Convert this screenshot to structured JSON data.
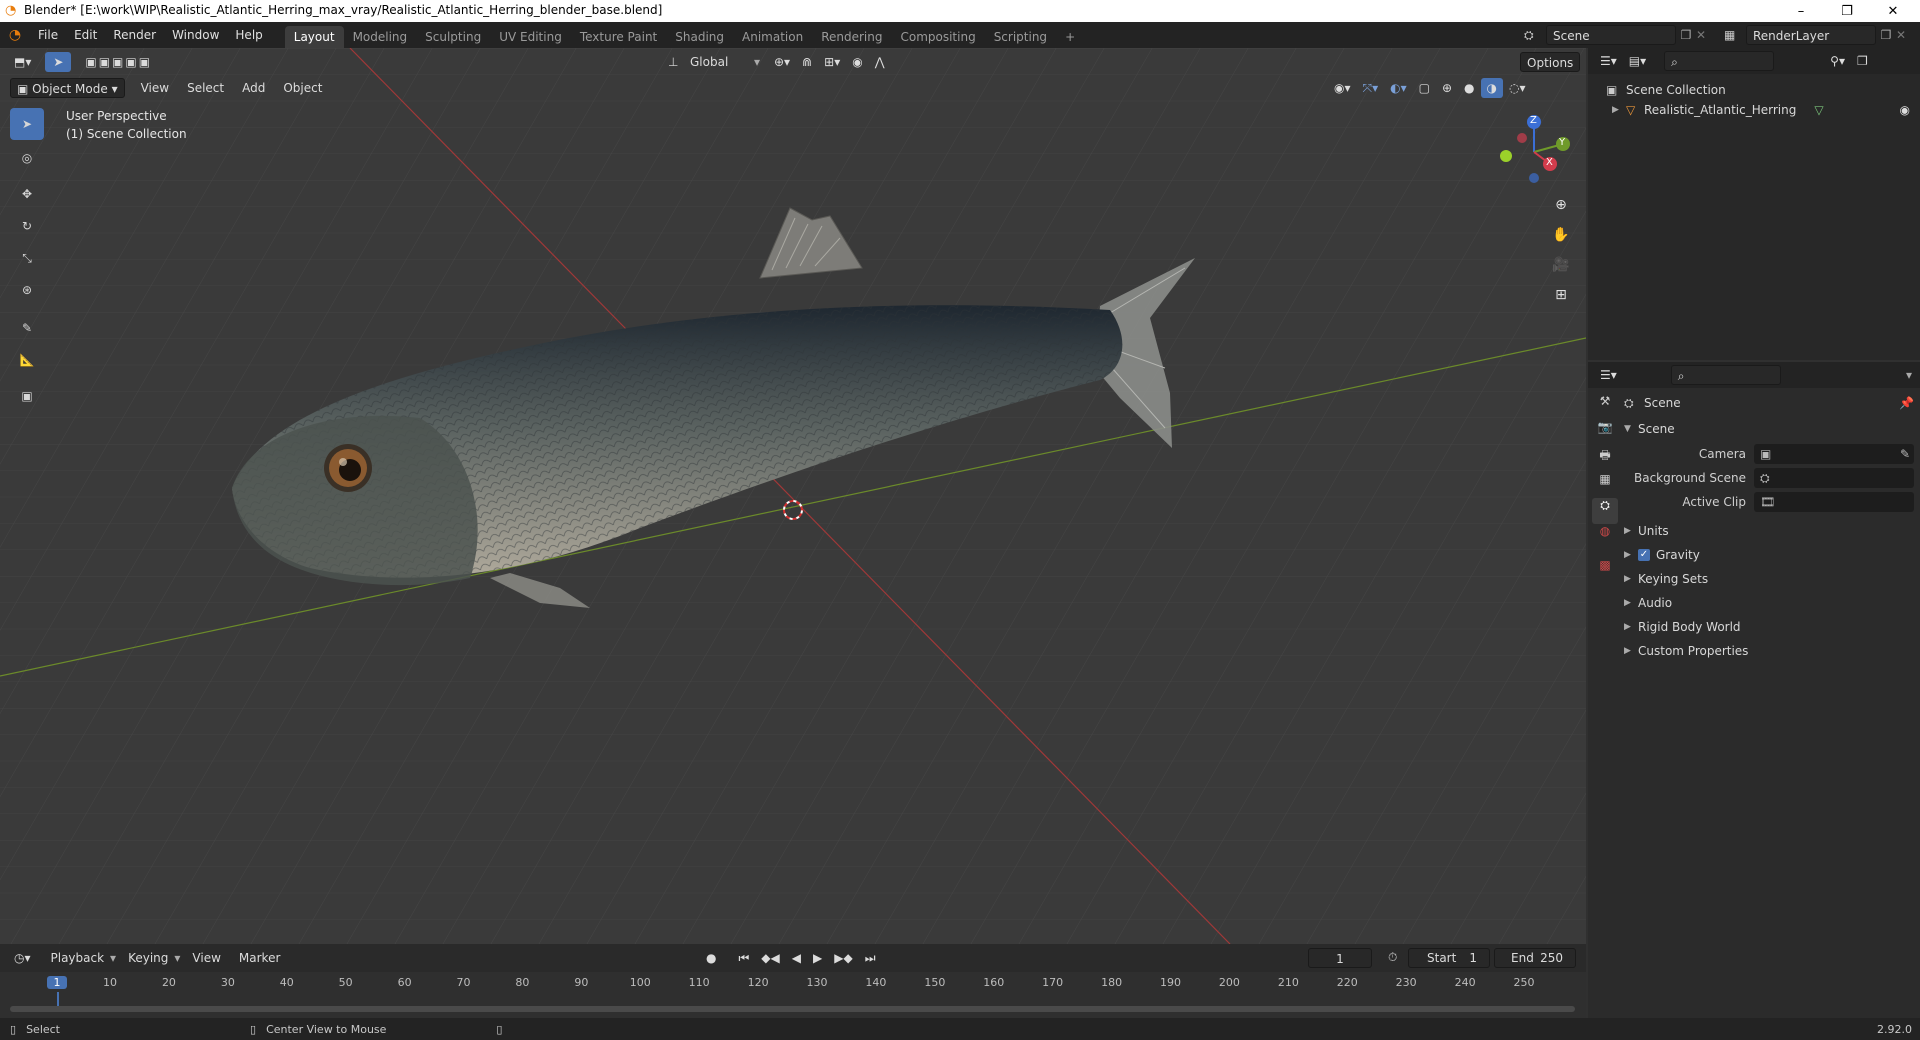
{
  "window": {
    "title": "Blender* [E:\\work\\WIP\\Realistic_Atlantic_Herring_max_vray/Realistic_Atlantic_Herring_blender_base.blend]",
    "minimize": "–",
    "maximize": "❐",
    "close": "✕"
  },
  "menu": [
    "File",
    "Edit",
    "Render",
    "Window",
    "Help"
  ],
  "workspaces": [
    "Layout",
    "Modeling",
    "Sculpting",
    "UV Editing",
    "Texture Paint",
    "Shading",
    "Animation",
    "Rendering",
    "Compositing",
    "Scripting"
  ],
  "workspace_add": "+",
  "scene_selector": {
    "value": "Scene"
  },
  "view_layer_selector": {
    "value": "RenderLayer"
  },
  "viewport_header": {
    "orientation": "Global",
    "options": "Options",
    "mode": "Object Mode",
    "menus": [
      "View",
      "Select",
      "Add",
      "Object"
    ]
  },
  "viewport_overlay": {
    "perspective": "User Perspective",
    "collection": "(1) Scene Collection"
  },
  "gizmo": {
    "z": "Z",
    "y": "Y",
    "x": "X"
  },
  "outliner": {
    "root": "Scene Collection",
    "items": [
      {
        "name": "Realistic_Atlantic_Herring"
      }
    ]
  },
  "properties": {
    "context": "Scene",
    "section": "Scene",
    "fields": [
      {
        "label": "Camera",
        "value": ""
      },
      {
        "label": "Background Scene",
        "value": ""
      },
      {
        "label": "Active Clip",
        "value": ""
      }
    ],
    "panels": [
      {
        "label": "Units",
        "checkbox": false
      },
      {
        "label": "Gravity",
        "checkbox": true
      },
      {
        "label": "Keying Sets",
        "checkbox": false
      },
      {
        "label": "Audio",
        "checkbox": false
      },
      {
        "label": "Rigid Body World",
        "checkbox": false
      },
      {
        "label": "Custom Properties",
        "checkbox": false
      }
    ]
  },
  "timeline": {
    "menus": [
      "Playback",
      "Keying",
      "View",
      "Marker"
    ],
    "current_frame": "1",
    "start_label": "Start",
    "start": "1",
    "end_label": "End",
    "end": "250",
    "ticks": [
      "1",
      "10",
      "20",
      "30",
      "40",
      "50",
      "60",
      "70",
      "80",
      "90",
      "100",
      "110",
      "120",
      "130",
      "140",
      "150",
      "160",
      "170",
      "180",
      "190",
      "200",
      "210",
      "220",
      "230",
      "240",
      "250"
    ]
  },
  "status": {
    "select": "Select",
    "center": "Center View to Mouse",
    "version": "2.92.0"
  }
}
